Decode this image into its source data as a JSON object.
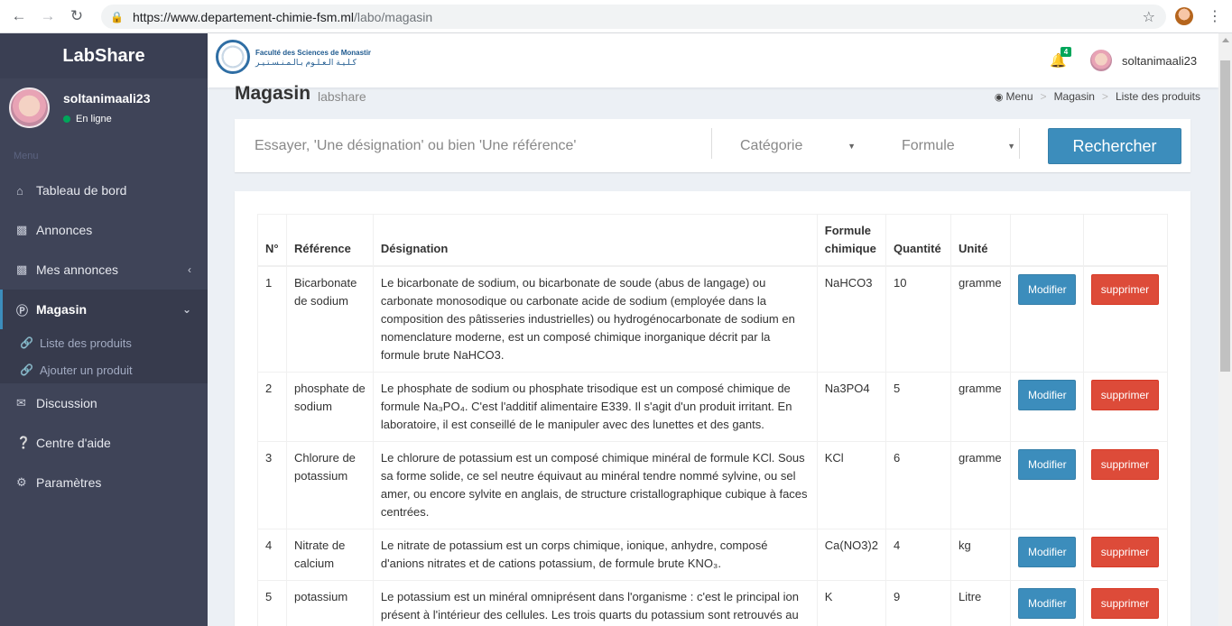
{
  "browser": {
    "url_host": "https://www.departement-chimie-fsm.ml",
    "url_path": "/labo/magasin"
  },
  "sidebar": {
    "brand": "LabShare",
    "user_name": "soltanimaali23",
    "user_status": "En ligne",
    "menu_header": "Menu",
    "items": [
      {
        "label": "Tableau de bord"
      },
      {
        "label": "Annonces"
      },
      {
        "label": "Mes annonces"
      },
      {
        "label": "Magasin"
      },
      {
        "label": "Discussion"
      },
      {
        "label": "Centre d'aide"
      },
      {
        "label": "Paramètres"
      }
    ],
    "submenu": [
      {
        "label": "Liste des produits"
      },
      {
        "label": "Ajouter un produit"
      }
    ]
  },
  "topbar": {
    "logo_fr": "Faculté des Sciences de Monastir",
    "logo_ar": "كـلـيـة الـعـلـوم بـالـمـنـسـتـيـر",
    "notif_count": "4",
    "username": "soltanimaali23"
  },
  "page": {
    "title": "Magasin",
    "subtitle": "labshare",
    "breadcrumb": [
      "Menu",
      "Magasin",
      "Liste des produits"
    ]
  },
  "search": {
    "placeholder": "Essayer, 'Une désignation' ou bien 'Une référence'",
    "categorie": "Catégorie",
    "formule": "Formule",
    "button": "Rechercher"
  },
  "table": {
    "headers": [
      "N°",
      "Référence",
      "Désignation",
      "Formule chimique",
      "Quantité",
      "Unité"
    ],
    "modifier_label": "Modifier",
    "supprimer_label": "supprimer",
    "rows": [
      {
        "n": "1",
        "ref": "Bicarbonate de sodium",
        "desig": "Le bicarbonate de sodium, ou bicarbonate de soude (abus de langage) ou carbonate monosodique ou carbonate acide de sodium (employée dans la composition des pâtisseries industrielles) ou hydrogénocarbonate de sodium en nomenclature moderne, est un composé chimique inorganique décrit par la formule brute NaHCO3.",
        "formule": "NaHCO3",
        "qte": "10",
        "unite": "gramme"
      },
      {
        "n": "2",
        "ref": "phosphate de sodium",
        "desig": "Le phosphate de sodium ou phosphate trisodique est un composé chimique de formule Na₃PO₄. C'est l'additif alimentaire E339. Il s'agit d'un produit irritant. En laboratoire, il est conseillé de le manipuler avec des lunettes et des gants.",
        "formule": "Na3PO4",
        "qte": "5",
        "unite": "gramme"
      },
      {
        "n": "3",
        "ref": "Chlorure de potassium",
        "desig": "Le chlorure de potassium est un composé chimique minéral de formule KCl. Sous sa forme solide, ce sel neutre équivaut au minéral tendre nommé sylvine, ou sel amer, ou encore sylvite en anglais, de structure cristallographique cubique à faces centrées.",
        "formule": "KCl",
        "qte": "6",
        "unite": "gramme"
      },
      {
        "n": "4",
        "ref": "Nitrate de calcium",
        "desig": "Le nitrate de potassium est un corps chimique, ionique, anhydre, composé d'anions nitrates et de cations potassium, de formule brute KNO₃.",
        "formule": "Ca(NO3)2",
        "qte": "4",
        "unite": "kg"
      },
      {
        "n": "5",
        "ref": "potassium",
        "desig": "Le potassium est un minéral omniprésent dans l'organisme : c'est le principal ion présent à l'intérieur des cellules. Les trois quarts du potassium sont retrouvés au",
        "formule": "K",
        "qte": "9",
        "unite": "Litre"
      }
    ]
  }
}
